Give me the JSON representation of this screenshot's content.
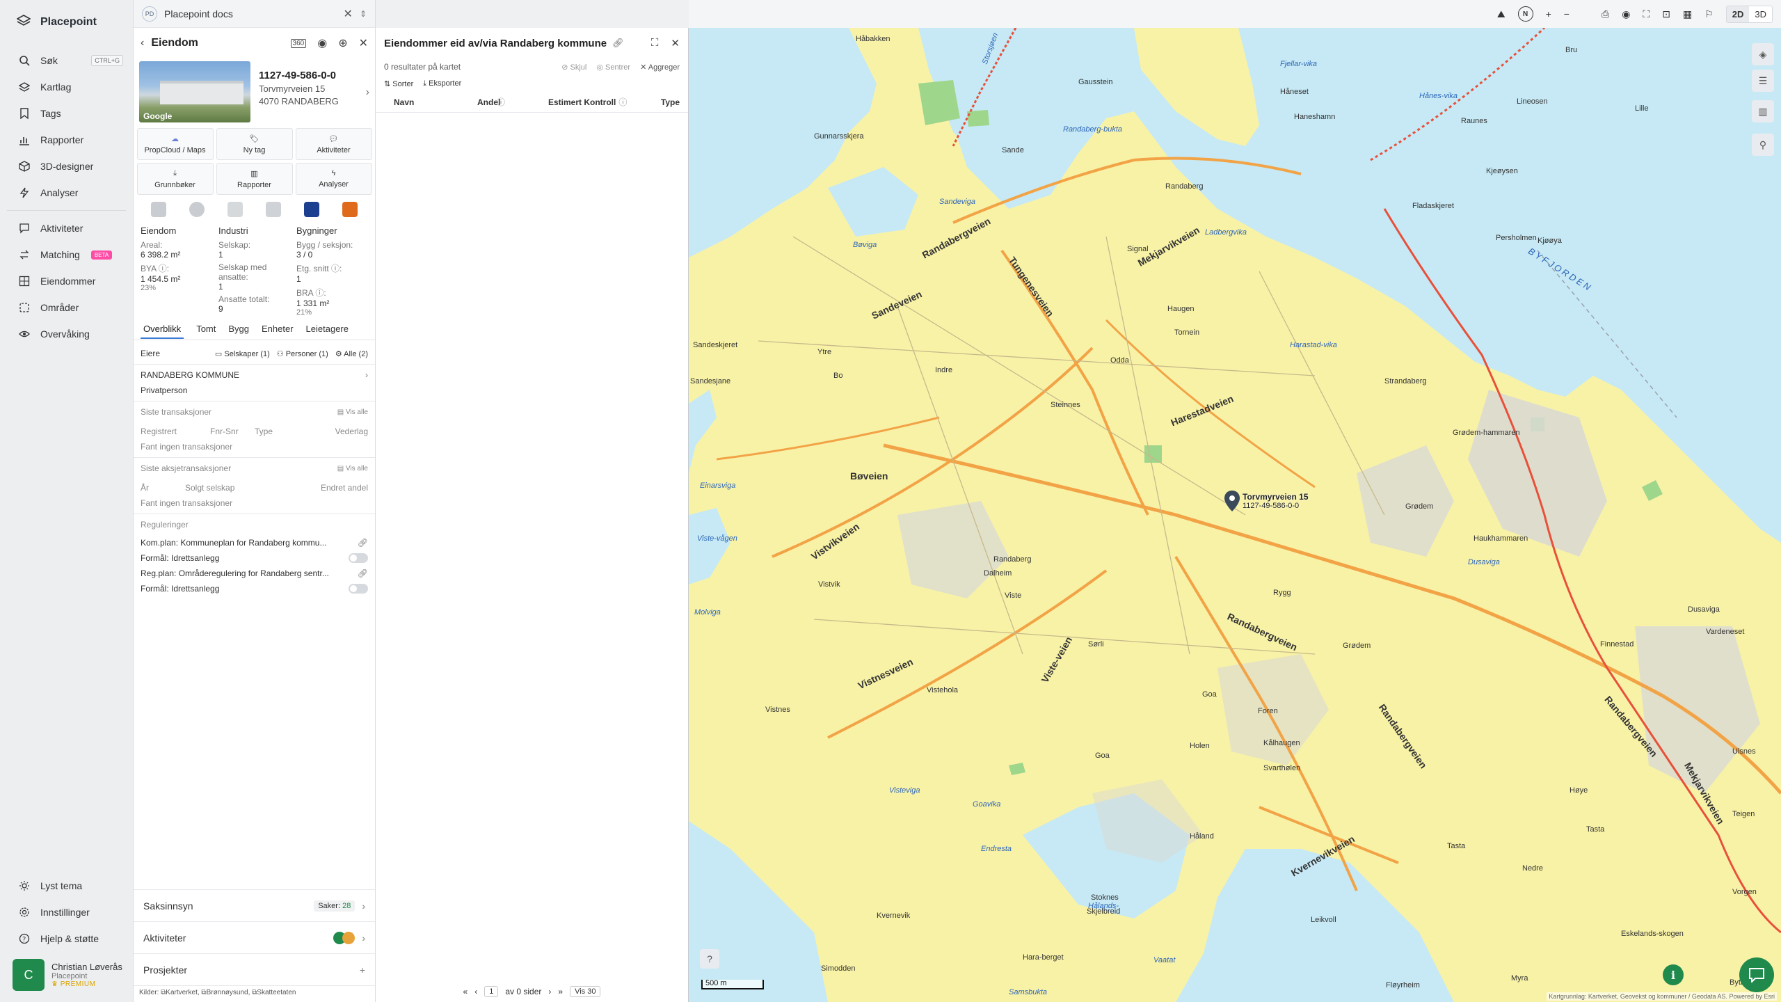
{
  "nav": {
    "brand": "Placepoint",
    "items": [
      {
        "label": "Søk",
        "shortcut": "CTRL+G",
        "icon": "search-icon"
      },
      {
        "label": "Kartlag",
        "icon": "layers-icon"
      },
      {
        "label": "Tags",
        "icon": "bookmark-icon"
      },
      {
        "label": "Rapporter",
        "icon": "chart-icon"
      },
      {
        "label": "3D-designer",
        "icon": "cube-icon"
      },
      {
        "label": "Analyser",
        "icon": "bolt-icon"
      },
      {
        "label": "Aktiviteter",
        "icon": "chat-icon"
      },
      {
        "label": "Matching",
        "badge": "BETA",
        "icon": "match-icon"
      },
      {
        "label": "Eiendommer",
        "icon": "grid-icon"
      },
      {
        "label": "Områder",
        "icon": "area-icon"
      },
      {
        "label": "Overvåking",
        "icon": "eye-icon"
      }
    ],
    "bottom": [
      {
        "label": "Lyst tema",
        "icon": "sun-icon"
      },
      {
        "label": "Innstillinger",
        "icon": "gear-icon"
      },
      {
        "label": "Hjelp & støtte",
        "icon": "help-icon"
      }
    ],
    "user": {
      "initial": "C",
      "name": "Christian Løverås",
      "org": "Placepoint",
      "plan": "PREMIUM"
    }
  },
  "doc": {
    "badge": "PD",
    "title": "Placepoint docs"
  },
  "property": {
    "header": "Eiendom",
    "id": "1127-49-586-0-0",
    "street": "Torvmyrveien 15",
    "postal": "4070 RANDABERG",
    "photo_label": "Google",
    "actions": [
      "PropCloud / Maps",
      "Ny tag",
      "Aktiviteter",
      "Grunnbøker",
      "Rapporter",
      "Analyser"
    ],
    "stats": {
      "col1": {
        "title": "Eiendom",
        "areal_label": "Areal:",
        "areal": "6 398.2 m²",
        "bya_label": "BYA ⓘ:",
        "bya": "1 454.5 m²",
        "bya_pct": "23%"
      },
      "col2": {
        "title": "Industri",
        "selskap_label": "Selskap:",
        "selskap": "1",
        "ansatte_label": "Selskap med ansatte:",
        "ansatte": "1",
        "totalt_label": "Ansatte totalt:",
        "totalt": "9"
      },
      "col3": {
        "title": "Bygninger",
        "bygg_label": "Bygg / seksjon:",
        "bygg": "3 / 0",
        "etg_label": "Etg. snitt ⓘ:",
        "etg": "1",
        "bra_label": "BRA ⓘ:",
        "bra": "1 331 m²",
        "bra_pct": "21%"
      }
    },
    "tabs": [
      "Overblikk",
      "Tomt",
      "Bygg",
      "Enheter",
      "Leietagere"
    ],
    "owners": {
      "label": "Eiere",
      "selskaper": "Selskaper (1)",
      "personer": "Personer (1)",
      "alle": "Alle (2)",
      "name": "RANDABERG KOMMUNE",
      "type": "Privatperson"
    },
    "transactions": {
      "title": "Siste transaksjoner",
      "see_all": "Vis alle",
      "cols": [
        "Registrert",
        "Fnr-Snr",
        "Type",
        "Vederlag"
      ],
      "empty": "Fant ingen transaksjoner"
    },
    "share_tx": {
      "title": "Siste aksjetransaksjoner",
      "see_all": "Vis alle",
      "cols": [
        "År",
        "Solgt selskap",
        "Endret andel"
      ],
      "empty": "Fant ingen transaksjoner"
    },
    "regulations": {
      "title": "Reguleringer",
      "items": [
        "Kom.plan: Kommuneplan for Randaberg kommu...",
        "Formål: Idrettsanlegg",
        "Reg.plan: Områderegulering for Randaberg sentr...",
        "Formål: Idrettsanlegg"
      ]
    },
    "saksinnsyn": {
      "label": "Saksinnsyn",
      "cases_label": "Saker:",
      "cases": "28"
    },
    "aktiviteter": "Aktiviteter",
    "prosjekter": "Prosjekter",
    "sources": {
      "label": "Kilder:",
      "items": [
        "Kartverket,",
        "Brønnøysund,",
        "Skatteetaten"
      ]
    }
  },
  "results": {
    "title": "Eiendommer eid av/via Randaberg kommune",
    "count": "0 resultater på kartet",
    "actions": [
      "Skjul",
      "Sentrer",
      "Aggreger"
    ],
    "tools": [
      "Sorter",
      "Eksporter"
    ],
    "columns": [
      "Navn",
      "Andel",
      "Estimert Kontroll",
      "Type"
    ],
    "pager": {
      "page": "1",
      "of": "av 0 sider",
      "size": "Vis 30"
    }
  },
  "topbar": {
    "mode2d": "2D",
    "mode3d": "3D"
  },
  "map": {
    "scale": "500 m",
    "attribution": "Kartgrunnlag: Kartverket, Geovekst og kommuner / Geodata AS. Powered by Esri",
    "pin_label": "Torvmyrveien 15",
    "pin_sub": "1127-49-586-0-0",
    "places": [
      "Håbakken",
      "Gausstein",
      "Håneset",
      "Lineosen",
      "Raunes",
      "Lille",
      "Gunnarsskjera",
      "Sande",
      "Randaberg",
      "Haneshamn",
      "Bru",
      "Kjeøysen",
      "Fladaskjeret",
      "Persholmen",
      "Kjøøya",
      "Sandeskjeret",
      "Sandesjane",
      "Ytre",
      "Bo",
      "Indre",
      "Steinnes",
      "Odda",
      "Tornein",
      "Haugen",
      "Signal",
      "Strandaberg",
      "Grødem-hammaren",
      "Grødem",
      "Haukhammaren",
      "Randaberg",
      "Dalheim",
      "Viste",
      "Vistvik",
      "Rygg",
      "Sørli",
      "Grødem",
      "Goa",
      "Foren",
      "Kålhaugen",
      "Svarthølen",
      "Vistnes",
      "Vistehola",
      "Goa",
      "Holen",
      "Håland",
      "Tasta",
      "Nedre",
      "Kvernevik",
      "Skjelbreid",
      "Stoknes",
      "Leikvoll",
      "Eskelands-skogen",
      "Dusaviga",
      "Vardeneset",
      "Finnestad",
      "Høye",
      "Tasta",
      "Simodden",
      "Hara-berget",
      "Fløyrheim",
      "Myra",
      "Ulsnes",
      "Bytangen",
      "Teigen",
      "Vorgen"
    ],
    "waters": [
      "Sandeviga",
      "Bøviga",
      "Randaberg-bukta",
      "Ladbergvika",
      "Harastad-vika",
      "Einarsviga",
      "Visteviga",
      "Viste-vågen",
      "Molviga",
      "Dusaviga",
      "Goavika",
      "Endresta",
      "Hålands-",
      "Vaatat",
      "Fjellar-vika",
      "Hånes-vika",
      "BYFJORDEN",
      "Storsjøen",
      "Samsbukta"
    ],
    "roads": [
      "Randabergveien",
      "Sandeveien",
      "Tungenesveien",
      "Mekjarvikveien",
      "Bøveien",
      "Vistvikveien",
      "Harestadveien",
      "Randabergveien",
      "Vistnesveien",
      "Viste-veien",
      "Kvernevikveien",
      "Randabergveien",
      "Mekjarvikveien",
      "Randabergveien"
    ]
  }
}
